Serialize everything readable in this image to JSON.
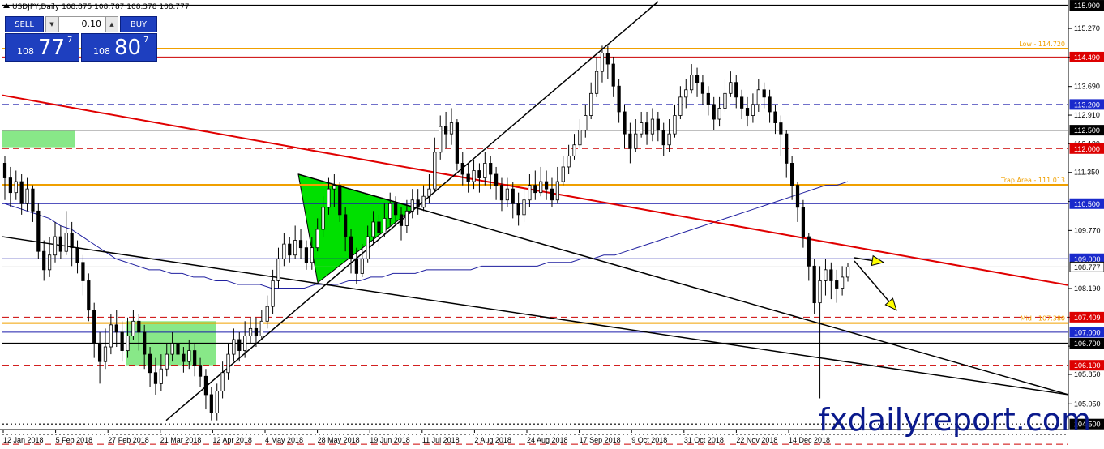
{
  "window": {
    "title": "USDJPY,Daily  108.875 108.787 108.378 108.777"
  },
  "ticket": {
    "sell_label": "SELL",
    "buy_label": "BUY",
    "lot": "0.10",
    "sell_prefix": "108",
    "sell_big": "77",
    "sell_sup": "7",
    "buy_prefix": "108",
    "buy_big": "80",
    "buy_sup": "7"
  },
  "watermark": "fxdailyreport.com",
  "colors": {
    "candle": "#000000",
    "trendline_red": "#e00000",
    "level_red": "#cc0000",
    "level_blue": "#1a1aaa",
    "level_orange": "#f0a000",
    "ma": "#2020a0",
    "triangle_fill": "#00e000",
    "box_fill": "#88e888",
    "arrow_fill": "#ffff00"
  },
  "chart_data": {
    "type": "candlestick",
    "symbol": "USDJPY",
    "timeframe": "Daily",
    "last_price": "108.777",
    "ylim": [
      104.35,
      116.0
    ],
    "x_ticks": [
      "12 Jan 2018",
      "5 Feb 2018",
      "27 Feb 2018",
      "21 Mar 2018",
      "12 Apr 2018",
      "4 May 2018",
      "28 May 2018",
      "19 Jun 2018",
      "11 Jul 2018",
      "2 Aug 2018",
      "24 Aug 2018",
      "17 Sep 2018",
      "9 Oct 2018",
      "31 Oct 2018",
      "22 Nov 2018",
      "14 Dec 2018"
    ],
    "y_ticks": [
      "115.270",
      "114.490",
      "113.690",
      "112.910",
      "112.130",
      "111.350",
      "110.560",
      "109.770",
      "108.190",
      "107.409",
      "106.620",
      "105.850",
      "105.050"
    ],
    "price_labels": [
      {
        "value": 115.9,
        "text": "115.900",
        "style": "black"
      },
      {
        "value": 114.49,
        "text": "114.490",
        "style": "red"
      },
      {
        "value": 113.2,
        "text": "113.200",
        "style": "blue"
      },
      {
        "value": 112.5,
        "text": "112.500",
        "style": "black"
      },
      {
        "value": 112.0,
        "text": "112.000",
        "style": "red"
      },
      {
        "value": 110.5,
        "text": "110.500",
        "style": "blue"
      },
      {
        "value": 109.0,
        "text": "109.000",
        "style": "blue"
      },
      {
        "value": 108.777,
        "text": "108.777",
        "style": "current"
      },
      {
        "value": 107.409,
        "text": "107.409",
        "style": "red"
      },
      {
        "value": 107.0,
        "text": "107.000",
        "style": "blue"
      },
      {
        "value": 106.7,
        "text": "106.700",
        "style": "black"
      },
      {
        "value": 106.1,
        "text": "106.100",
        "style": "red"
      },
      {
        "value": 104.5,
        "text": "104.500",
        "style": "black"
      }
    ],
    "horizontal_levels": [
      {
        "value": 115.9,
        "style": "black-solid"
      },
      {
        "value": 114.72,
        "style": "orange-solid",
        "label": "Low - 114.720"
      },
      {
        "value": 114.49,
        "style": "red-solid"
      },
      {
        "value": 113.2,
        "style": "blue-dashed"
      },
      {
        "value": 112.5,
        "style": "black-solid"
      },
      {
        "value": 112.0,
        "style": "red-dashed"
      },
      {
        "value": 111.013,
        "style": "orange-solid",
        "label": "Trap Area - 111.013"
      },
      {
        "value": 110.5,
        "style": "blue-solid"
      },
      {
        "value": 109.0,
        "style": "blue-solid"
      },
      {
        "value": 108.777,
        "style": "grey-solid"
      },
      {
        "value": 107.409,
        "style": "red-dashed"
      },
      {
        "value": 107.25,
        "style": "orange-solid",
        "label": "Mid - 107.380"
      },
      {
        "value": 107.0,
        "style": "blue-solid"
      },
      {
        "value": 106.7,
        "style": "black-solid"
      },
      {
        "value": 106.1,
        "style": "red-dashed"
      },
      {
        "value": 104.5,
        "style": "black-dotted"
      },
      {
        "value": 104.22,
        "style": "black-dotted"
      },
      {
        "value": 103.95,
        "style": "red-dashed"
      }
    ],
    "candles": [
      [
        111.6,
        111.2,
        111.8,
        110.6
      ],
      [
        111.2,
        110.8,
        111.5,
        110.4
      ],
      [
        110.8,
        111.1,
        111.4,
        110.6
      ],
      [
        111.1,
        110.5,
        111.3,
        110.2
      ],
      [
        110.5,
        110.9,
        111.2,
        110.3
      ],
      [
        110.9,
        110.3,
        111.0,
        110.0
      ],
      [
        110.3,
        109.2,
        110.5,
        109.0
      ],
      [
        109.2,
        108.7,
        109.5,
        108.4
      ],
      [
        108.7,
        109.1,
        109.6,
        108.5
      ],
      [
        109.1,
        109.6,
        110.0,
        108.9
      ],
      [
        109.6,
        109.2,
        109.9,
        109.0
      ],
      [
        109.2,
        109.7,
        110.3,
        109.1
      ],
      [
        109.7,
        109.3,
        110.0,
        108.8
      ],
      [
        109.3,
        108.9,
        109.5,
        108.6
      ],
      [
        108.9,
        108.4,
        109.1,
        108.0
      ],
      [
        108.4,
        107.6,
        108.6,
        107.3
      ],
      [
        107.6,
        106.7,
        107.8,
        106.3
      ],
      [
        106.7,
        106.2,
        107.0,
        105.6
      ],
      [
        106.2,
        106.6,
        107.1,
        106.0
      ],
      [
        106.6,
        107.2,
        107.5,
        106.4
      ],
      [
        107.2,
        107.0,
        107.6,
        106.6
      ],
      [
        107.0,
        106.5,
        107.3,
        106.2
      ],
      [
        106.5,
        106.9,
        107.4,
        106.3
      ],
      [
        106.9,
        107.3,
        107.6,
        106.8
      ],
      [
        107.3,
        107.0,
        107.5,
        106.5
      ],
      [
        107.0,
        106.4,
        107.2,
        106.0
      ],
      [
        106.4,
        105.9,
        106.6,
        105.5
      ],
      [
        105.9,
        105.6,
        106.3,
        105.3
      ],
      [
        105.6,
        106.0,
        106.4,
        105.4
      ],
      [
        106.0,
        106.4,
        106.7,
        105.8
      ],
      [
        106.4,
        106.7,
        107.0,
        106.2
      ],
      [
        106.7,
        106.4,
        106.9,
        106.1
      ],
      [
        106.4,
        106.2,
        106.6,
        105.9
      ],
      [
        106.2,
        106.5,
        106.8,
        106.0
      ],
      [
        106.5,
        106.1,
        106.7,
        105.8
      ],
      [
        106.1,
        105.8,
        106.3,
        105.5
      ],
      [
        105.8,
        105.3,
        106.0,
        104.9
      ],
      [
        105.3,
        104.8,
        105.5,
        104.6
      ],
      [
        104.8,
        105.4,
        105.6,
        104.6
      ],
      [
        105.4,
        105.9,
        106.2,
        105.2
      ],
      [
        105.9,
        106.4,
        106.7,
        105.7
      ],
      [
        106.4,
        106.8,
        107.1,
        106.2
      ],
      [
        106.8,
        106.5,
        107.0,
        106.2
      ],
      [
        106.5,
        106.9,
        107.3,
        106.3
      ],
      [
        106.9,
        107.1,
        107.4,
        106.7
      ],
      [
        107.1,
        106.9,
        107.4,
        106.6
      ],
      [
        106.9,
        107.3,
        107.6,
        106.8
      ],
      [
        107.3,
        107.7,
        108.0,
        107.1
      ],
      [
        107.7,
        108.4,
        108.7,
        107.5
      ],
      [
        108.4,
        109.0,
        109.3,
        108.2
      ],
      [
        109.0,
        109.4,
        109.7,
        108.8
      ],
      [
        109.4,
        109.1,
        109.6,
        108.9
      ],
      [
        109.1,
        109.5,
        109.9,
        109.0
      ],
      [
        109.5,
        109.3,
        109.8,
        109.0
      ],
      [
        109.3,
        108.9,
        109.5,
        108.7
      ],
      [
        108.9,
        109.3,
        109.6,
        108.7
      ],
      [
        109.3,
        109.8,
        110.1,
        109.2
      ],
      [
        109.8,
        110.4,
        110.7,
        109.6
      ],
      [
        110.4,
        110.9,
        111.2,
        110.2
      ],
      [
        110.9,
        111.0,
        111.3,
        110.4
      ],
      [
        111.0,
        110.2,
        111.1,
        110.0
      ],
      [
        110.2,
        109.6,
        110.4,
        109.2
      ],
      [
        109.6,
        109.0,
        109.8,
        108.6
      ],
      [
        109.0,
        108.6,
        109.3,
        108.3
      ],
      [
        108.6,
        109.0,
        109.4,
        108.5
      ],
      [
        109.0,
        109.6,
        109.9,
        108.9
      ],
      [
        109.6,
        110.0,
        110.3,
        109.4
      ],
      [
        110.0,
        109.7,
        110.2,
        109.3
      ],
      [
        109.7,
        110.1,
        110.5,
        109.6
      ],
      [
        110.1,
        110.5,
        110.8,
        109.9
      ],
      [
        110.5,
        110.2,
        110.7,
        109.9
      ],
      [
        110.2,
        109.9,
        110.4,
        109.5
      ],
      [
        109.9,
        110.3,
        110.6,
        109.7
      ],
      [
        110.3,
        110.6,
        110.9,
        110.1
      ],
      [
        110.6,
        110.4,
        110.9,
        110.2
      ],
      [
        110.4,
        110.7,
        111.0,
        110.3
      ],
      [
        110.7,
        110.9,
        111.3,
        110.5
      ],
      [
        110.9,
        111.9,
        112.3,
        110.8
      ],
      [
        111.9,
        112.6,
        112.9,
        111.7
      ],
      [
        112.6,
        112.4,
        113.0,
        112.0
      ],
      [
        112.4,
        112.7,
        113.1,
        112.1
      ],
      [
        112.7,
        111.6,
        112.8,
        111.4
      ],
      [
        111.6,
        111.3,
        111.9,
        111.0
      ],
      [
        111.3,
        111.1,
        111.6,
        110.8
      ],
      [
        111.1,
        111.4,
        111.7,
        110.9
      ],
      [
        111.4,
        111.2,
        111.6,
        110.8
      ],
      [
        111.2,
        111.6,
        111.9,
        111.0
      ],
      [
        111.6,
        111.3,
        111.8,
        110.9
      ],
      [
        111.3,
        111.0,
        111.5,
        110.6
      ],
      [
        111.0,
        110.6,
        111.2,
        110.3
      ],
      [
        110.6,
        110.9,
        111.2,
        110.4
      ],
      [
        110.9,
        110.5,
        111.1,
        110.1
      ],
      [
        110.5,
        110.2,
        110.8,
        109.9
      ],
      [
        110.2,
        110.6,
        110.9,
        110.0
      ],
      [
        110.6,
        111.0,
        111.3,
        110.4
      ],
      [
        111.0,
        110.8,
        111.4,
        110.6
      ],
      [
        110.8,
        111.1,
        111.5,
        110.7
      ],
      [
        111.1,
        110.9,
        111.4,
        110.6
      ],
      [
        110.9,
        110.6,
        111.2,
        110.4
      ],
      [
        110.6,
        111.1,
        111.5,
        110.5
      ],
      [
        111.1,
        111.5,
        111.8,
        111.0
      ],
      [
        111.5,
        111.8,
        112.1,
        111.3
      ],
      [
        111.8,
        112.1,
        112.4,
        111.7
      ],
      [
        112.1,
        112.5,
        112.8,
        112.0
      ],
      [
        112.5,
        112.9,
        113.2,
        112.3
      ],
      [
        112.9,
        113.5,
        113.8,
        112.8
      ],
      [
        113.5,
        114.1,
        114.5,
        113.4
      ],
      [
        114.1,
        114.6,
        114.8,
        113.8
      ],
      [
        114.6,
        114.3,
        114.8,
        113.9
      ],
      [
        114.3,
        113.7,
        114.5,
        113.4
      ],
      [
        113.7,
        113.0,
        113.9,
        112.7
      ],
      [
        113.0,
        112.4,
        113.2,
        112.0
      ],
      [
        112.4,
        112.0,
        112.7,
        111.6
      ],
      [
        112.0,
        112.4,
        112.8,
        111.9
      ],
      [
        112.4,
        112.7,
        113.0,
        112.3
      ],
      [
        112.7,
        112.4,
        113.0,
        112.1
      ],
      [
        112.4,
        112.8,
        113.1,
        112.2
      ],
      [
        112.8,
        112.5,
        113.0,
        112.2
      ],
      [
        112.5,
        112.1,
        112.7,
        111.8
      ],
      [
        112.1,
        112.4,
        112.8,
        111.9
      ],
      [
        112.4,
        112.9,
        113.2,
        112.3
      ],
      [
        112.9,
        113.4,
        113.7,
        112.8
      ],
      [
        113.4,
        113.6,
        113.9,
        113.1
      ],
      [
        113.6,
        114.0,
        114.3,
        113.5
      ],
      [
        114.0,
        113.8,
        114.2,
        113.4
      ],
      [
        113.8,
        113.5,
        114.0,
        113.2
      ],
      [
        113.5,
        113.2,
        113.7,
        112.9
      ],
      [
        113.2,
        112.8,
        113.4,
        112.5
      ],
      [
        112.8,
        113.1,
        113.4,
        112.6
      ],
      [
        113.1,
        113.5,
        113.9,
        113.0
      ],
      [
        113.5,
        113.8,
        114.1,
        113.4
      ],
      [
        113.8,
        113.4,
        114.0,
        113.1
      ],
      [
        113.4,
        113.1,
        113.6,
        112.8
      ],
      [
        113.1,
        112.9,
        113.4,
        112.6
      ],
      [
        112.9,
        113.2,
        113.5,
        112.7
      ],
      [
        113.2,
        113.6,
        113.9,
        113.0
      ],
      [
        113.6,
        113.4,
        113.8,
        113.1
      ],
      [
        113.4,
        113.0,
        113.6,
        112.7
      ],
      [
        113.0,
        112.7,
        113.2,
        112.4
      ],
      [
        112.7,
        112.4,
        112.9,
        111.8
      ],
      [
        112.4,
        111.6,
        112.5,
        111.2
      ],
      [
        111.6,
        111.0,
        111.8,
        110.6
      ],
      [
        111.0,
        110.4,
        111.1,
        110.0
      ],
      [
        110.4,
        109.6,
        110.6,
        109.3
      ],
      [
        109.6,
        108.8,
        109.7,
        108.4
      ],
      [
        108.8,
        107.8,
        109.0,
        107.5
      ],
      [
        107.8,
        108.4,
        108.8,
        105.2
      ],
      [
        108.4,
        108.7,
        109.0,
        108.0
      ],
      [
        108.7,
        108.4,
        108.9,
        107.9
      ],
      [
        108.4,
        108.2,
        108.7,
        107.8
      ],
      [
        108.2,
        108.5,
        108.8,
        108.0
      ],
      [
        108.5,
        108.777,
        108.875,
        108.378
      ]
    ],
    "moving_average": [
      110.5,
      110.4,
      110.3,
      110.2,
      110.1,
      109.9,
      109.8,
      109.6,
      109.4,
      109.2,
      109.0,
      108.9,
      108.8,
      108.7,
      108.7,
      108.6,
      108.6,
      108.5,
      108.5,
      108.4,
      108.4,
      108.3,
      108.3,
      108.3,
      108.2,
      108.2,
      108.2,
      108.2,
      108.3,
      108.3,
      108.3,
      108.4,
      108.4,
      108.5,
      108.5,
      108.6,
      108.6,
      108.6,
      108.7,
      108.7,
      108.7,
      108.7,
      108.7,
      108.8,
      108.8,
      108.8,
      108.8,
      108.8,
      108.8,
      108.9,
      108.9,
      108.9,
      109.0,
      109.0,
      109.1,
      109.1,
      109.2,
      109.3,
      109.4,
      109.5,
      109.6,
      109.7,
      109.8,
      109.9,
      110.0,
      110.1,
      110.2,
      110.3,
      110.4,
      110.5,
      110.6,
      110.7,
      110.8,
      110.9,
      111.0,
      111.0,
      111.1
    ],
    "annotations": [
      "Low - 114.720",
      "Trap Area - 111.013",
      "Mid - 107.380"
    ]
  }
}
